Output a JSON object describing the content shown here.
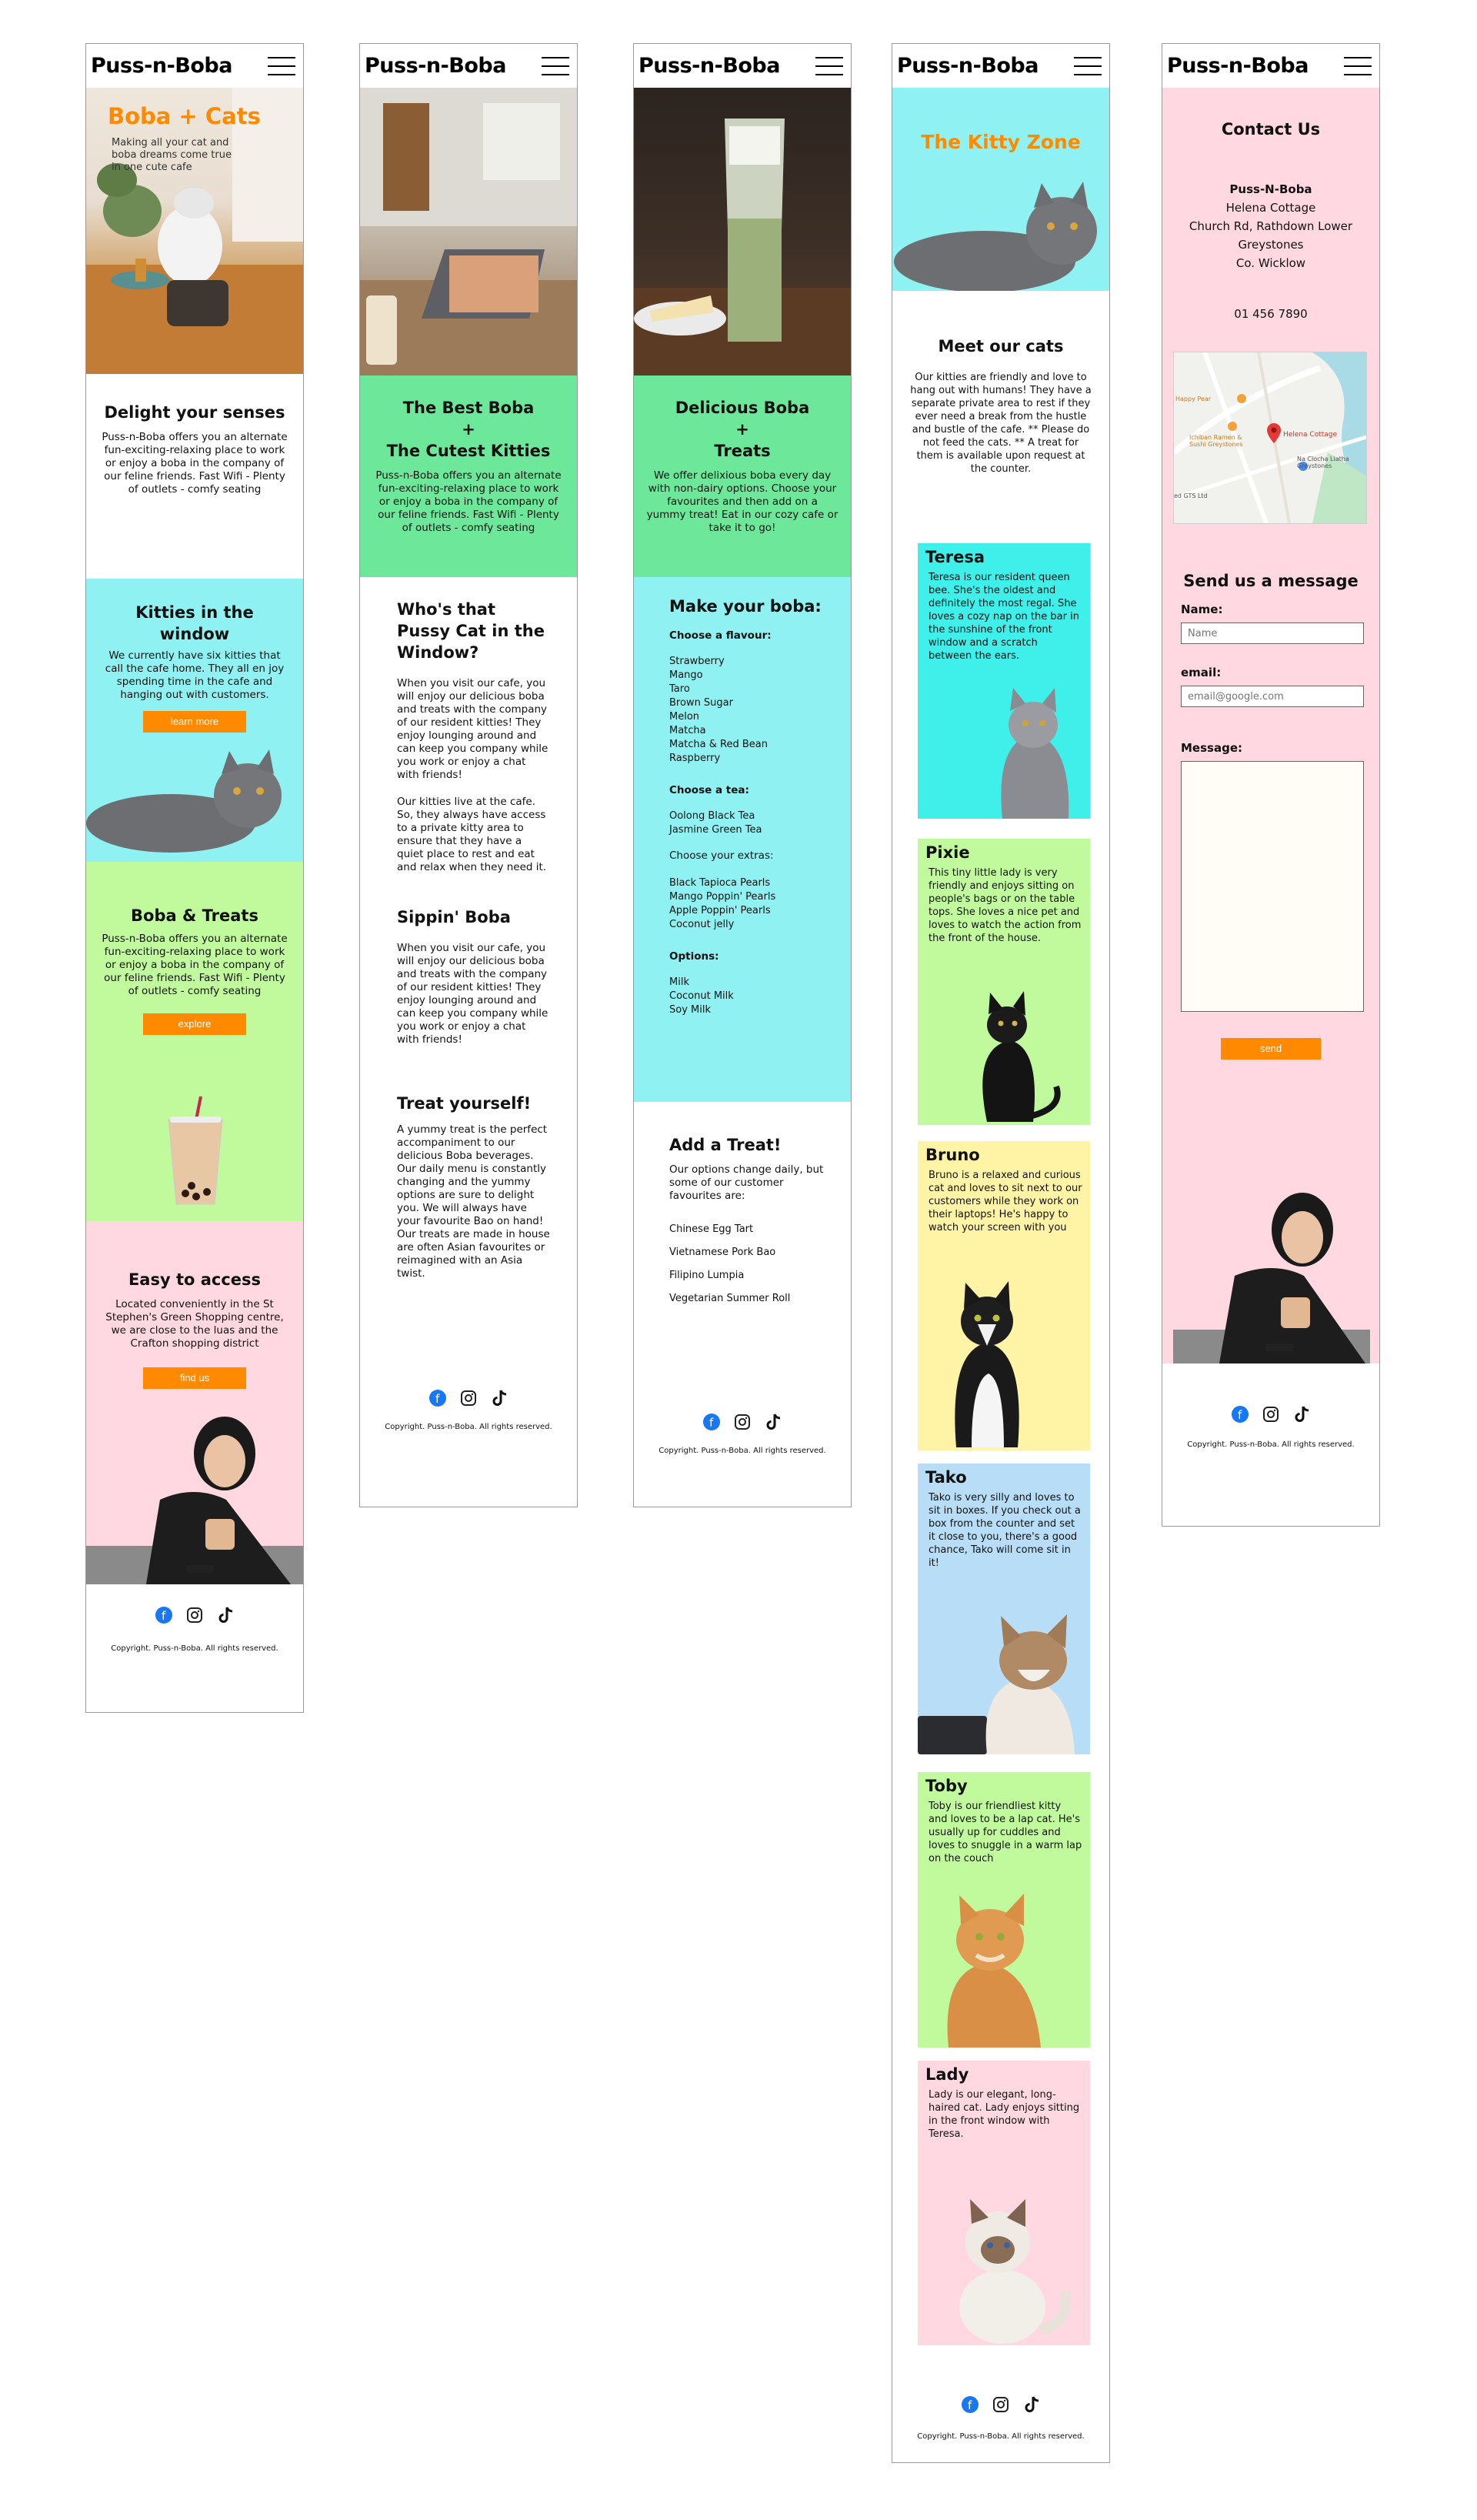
{
  "brand": "Puss-n-Boba",
  "colors": {
    "orange": "#ff8a00",
    "cyan": "#8ff1f1",
    "green": "#6de89a",
    "lime": "#c1fa9c",
    "pink": "#ffd8e1",
    "yellow": "#fff3a6",
    "blue": "#b7def6"
  },
  "icons": [
    "menu-icon",
    "facebook-icon",
    "instagram-icon",
    "tiktok-icon",
    "map-pin-icon"
  ],
  "footer": {
    "copyright": "Copyright. Puss-n-Boba. All rights reserved."
  },
  "home": {
    "hero_title": "Boba + Cats",
    "hero_sub": "Making all your cat and boba dreams come true in one cute cafe",
    "delight_title": "Delight your senses",
    "delight_text": "Puss-n-Boba offers you an alternate fun-exciting-relaxing place to work or enjoy a boba in the company of our feline friends. Fast Wifi - Plenty of outlets - comfy seating",
    "kitties_title": "Kitties in the window",
    "kitties_text": "We currently have six kitties that call the cafe home. They all en joy spending time in the cafe and hanging out with customers.",
    "kitties_button": "learn more",
    "treats_title": "Boba & Treats",
    "treats_text": "Puss-n-Boba offers you an alternate fun-exciting-relaxing place to work or enjoy a boba in the company of our feline friends. Fast Wifi - Plenty of outlets - comfy seating",
    "treats_button": "explore",
    "access_title": "Easy to access",
    "access_text": "Located conveniently in the St Stephen's Green Shopping centre, we are close to the luas and the Crafton shopping district",
    "access_button": "find us"
  },
  "about": {
    "hero_title_1": "The Best Boba",
    "hero_title_2": "+",
    "hero_title_3": "The Cutest Kitties",
    "hero_text": "Puss-n-Boba offers you an alternate fun-exciting-relaxing place to work or enjoy a boba in the company of our feline friends. Fast Wifi - Plenty of outlets - comfy seating",
    "s1_title": "Who's that Pussy Cat in the Window?",
    "s1_text_a": "When you visit our cafe, you will enjoy our delicious boba and treats with the company of our resident kitties! They enjoy lounging around and can keep you company while you work or enjoy a chat with friends!",
    "s1_text_b": "Our kitties live at the cafe. So, they always have access to a private kitty area to ensure that they have a quiet place to rest and eat and relax when they need it.",
    "s2_title": "Sippin' Boba",
    "s2_text": "When you visit our cafe, you will enjoy our delicious boba and treats with the company of our resident kitties! They enjoy lounging around and can keep you company while you work or enjoy a chat with friends!",
    "s3_title": "Treat yourself!",
    "s3_text": "A yummy treat is the perfect accompaniment to our delicious Boba beverages. Our daily menu is constantly changing and the yummy options are sure to delight you. We will always have your favourite Bao on hand! Our treats are made in house are often Asian favourites or reimagined with an Asia twist."
  },
  "menu": {
    "hero_title_1": "Delicious Boba",
    "hero_title_2": "+",
    "hero_title_3": "Treats",
    "hero_text": "We offer delixious boba every day with non-dairy options. Choose your favourites and then add on a yummy treat! Eat in our cozy cafe or take it to go!",
    "make_title": "Make your boba:",
    "flavour_label": "Choose a flavour:",
    "flavours": [
      "Strawberry",
      "Mango",
      "Taro",
      "Brown Sugar",
      "Melon",
      "Matcha",
      "Matcha & Red Bean",
      "Raspberry"
    ],
    "tea_label": "Choose a tea:",
    "teas": [
      "Oolong Black Tea",
      "Jasmine Green Tea"
    ],
    "extras_label": "Choose your extras:",
    "extras": [
      "Black Tapioca Pearls",
      "Mango Poppin' Pearls",
      "Apple Poppin' Pearls",
      "Coconut jelly"
    ],
    "options_label": "Options:",
    "options": [
      "Milk",
      "Coconut Milk",
      "Soy Milk"
    ],
    "treat_title": "Add a Treat!",
    "treat_text": "Our options change daily, but some of our customer favourites are:",
    "treats": [
      "Chinese Egg Tart",
      "Vietnamese Pork Bao",
      "Filipino Lumpia",
      "Vegetarian Summer Roll"
    ]
  },
  "kitty": {
    "hero_title": "The Kitty Zone",
    "meet_title": "Meet our cats",
    "meet_text": "Our kitties are friendly and love to hang out with humans! They have a separate private area to rest if they ever need a break from the hustle and bustle of the cafe. ** Please do not feed the cats. ** A treat for them is available upon request at the counter.",
    "cats": [
      {
        "name": "Teresa",
        "text": "Teresa is our resident queen bee. She's the oldest and definitely the most regal. She loves a cozy nap on the bar in the sunshine of the front window and a scratch between the ears."
      },
      {
        "name": "Pixie",
        "text": "This tiny little lady is very friendly and enjoys sitting on people's bags or on the table tops. She loves a nice pet and loves to watch the action from the front of the house."
      },
      {
        "name": "Bruno",
        "text": "Bruno is a relaxed and curious cat and loves to sit next to our customers while they work on their laptops! He's happy to watch your screen with you"
      },
      {
        "name": "Tako",
        "text": "Tako is very silly and loves to sit in boxes. If you check out a box from the counter and set it close to you, there's a good chance, Tako will come sit in it!"
      },
      {
        "name": "Toby",
        "text": "Toby is our friendliest kitty and loves to be a lap cat. He's usually up for cuddles and loves to snuggle in a warm lap on the couch"
      },
      {
        "name": "Lady",
        "text": "Lady is our elegant, long-haired cat. Lady enjoys sitting in the front window with Teresa."
      }
    ]
  },
  "contact": {
    "title": "Contact Us",
    "name": "Puss-N-Boba",
    "addr1": "Helena Cottage",
    "addr2": "Church Rd, Rathdown Lower",
    "addr3": "Greystones",
    "addr4": "Co. Wicklow",
    "phone": "01 456 7890",
    "map_labels": {
      "place": "Helena Cottage",
      "nearby_1": "Happy Pear",
      "nearby_2": "Ichiban Ramen & Sushi Greystones",
      "nearby_3": "Na Clocha Liatha Greystones",
      "nearby_4": "ed GTS Ltd"
    },
    "form_title": "Send us a message",
    "name_label": "Name:",
    "name_placeholder": "Name",
    "email_label": "email:",
    "email_placeholder": "email@google.com",
    "message_label": "Message:",
    "send_button": "send"
  }
}
